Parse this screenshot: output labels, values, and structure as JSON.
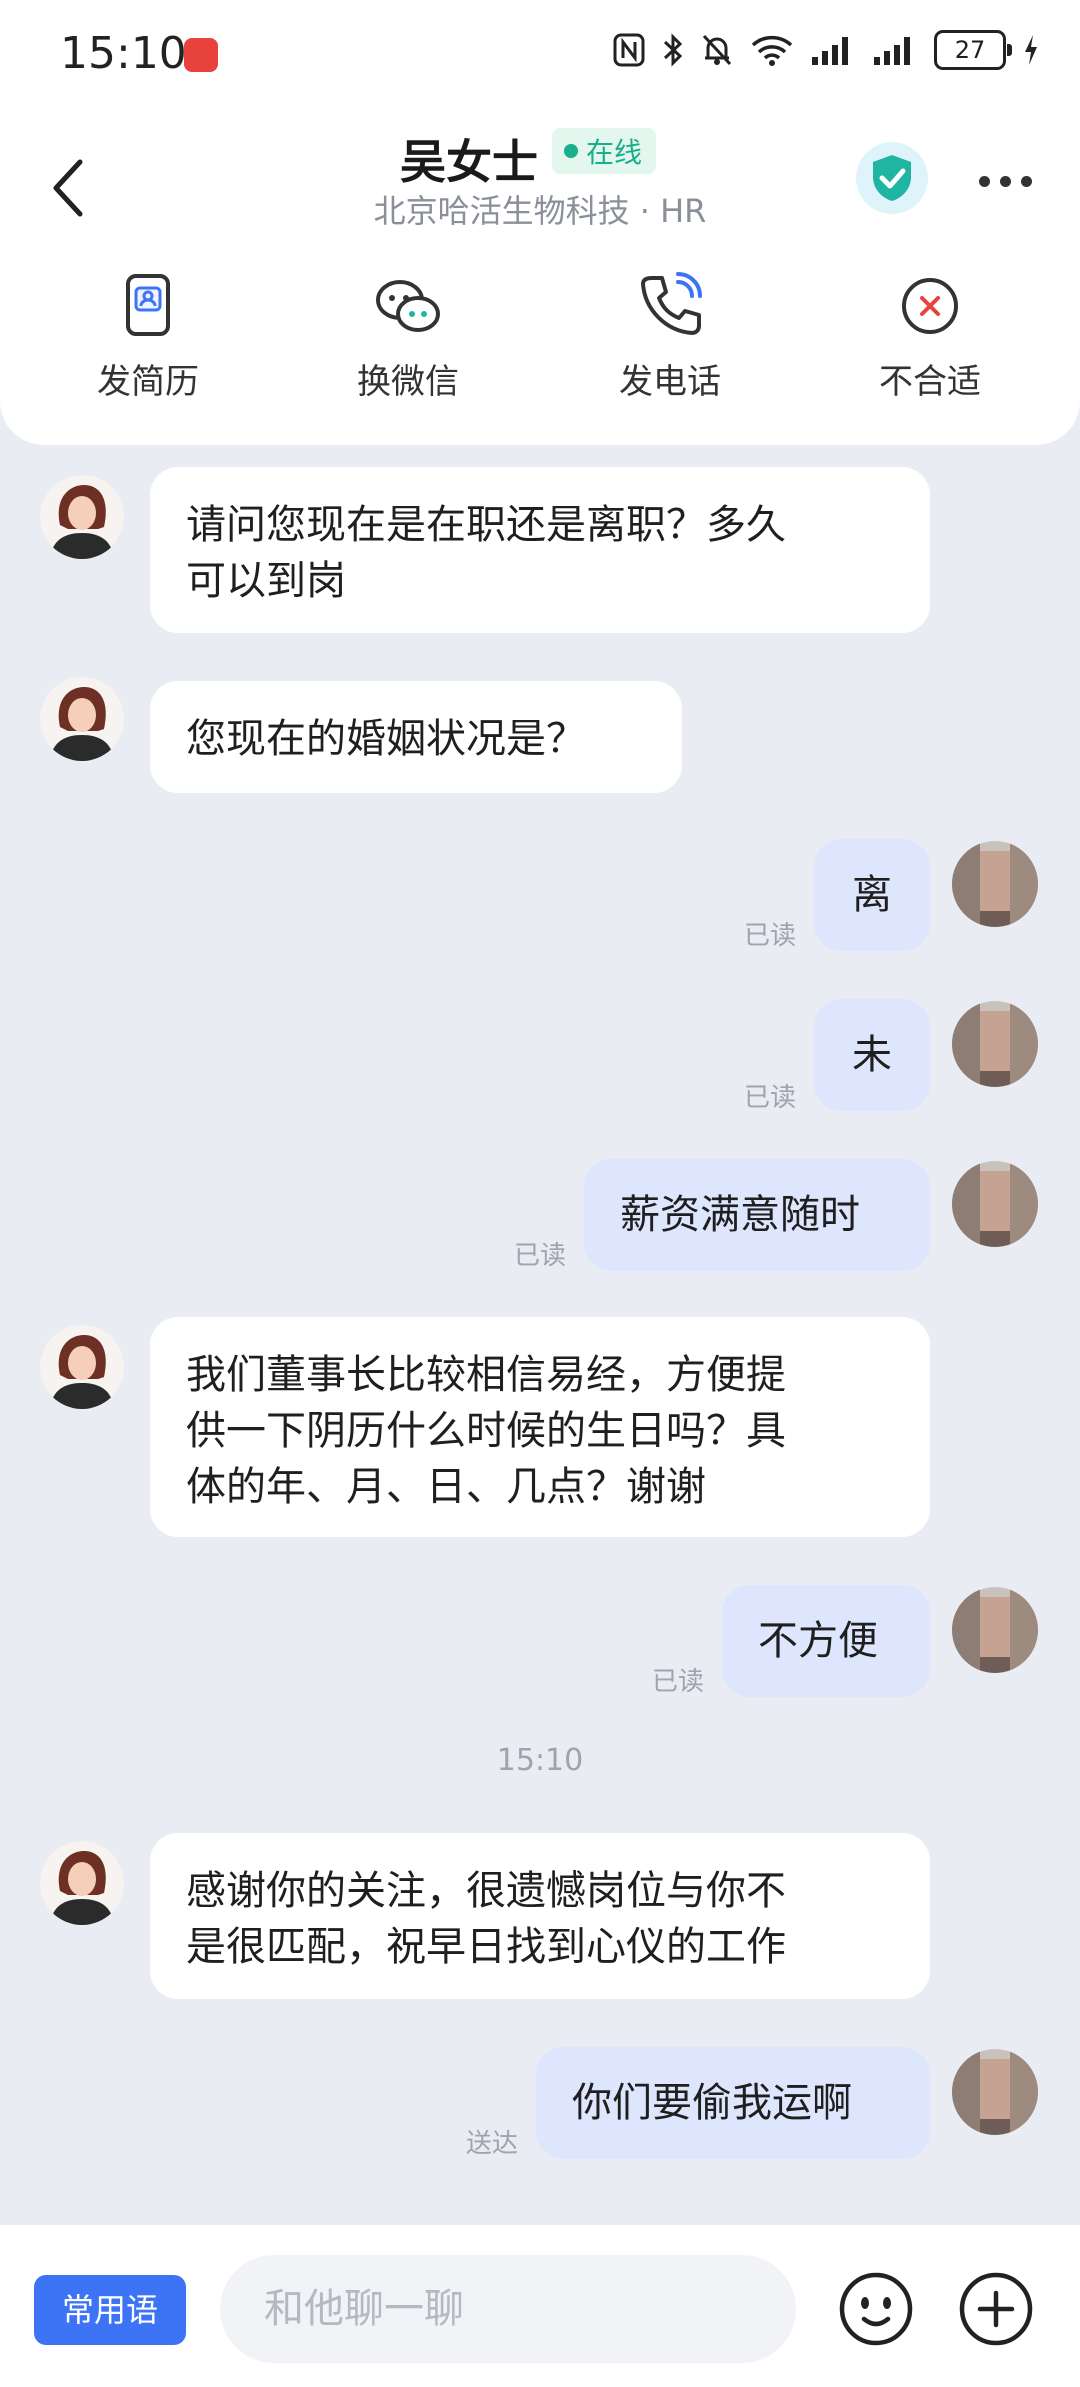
{
  "status_bar": {
    "time": "15:10",
    "battery": "27"
  },
  "header": {
    "name": "吴女士",
    "online": "在线",
    "subtitle": "北京哈活生物科技 · HR",
    "actions": [
      {
        "label": "发简历",
        "icon": "resume-icon"
      },
      {
        "label": "换微信",
        "icon": "wechat-icon"
      },
      {
        "label": "发电话",
        "icon": "phone-icon"
      },
      {
        "label": "不合适",
        "icon": "close-circle-icon"
      }
    ]
  },
  "messages": [
    {
      "from": "hr",
      "text_lines": [
        "请问您现在是在职还是离职？多久",
        "可以到岗"
      ]
    },
    {
      "from": "hr",
      "text_lines": [
        "您现在的婚姻状况是？"
      ]
    },
    {
      "from": "me",
      "text": "离",
      "status": "已读"
    },
    {
      "from": "me",
      "text": "未",
      "status": "已读"
    },
    {
      "from": "me",
      "text": "薪资满意随时",
      "status": "已读"
    },
    {
      "from": "hr",
      "text_lines": [
        "我们董事长比较相信易经，方便提",
        "供一下阴历什么时候的生日吗？具",
        "体的年、月、日、几点？谢谢"
      ]
    },
    {
      "from": "me",
      "text": "不方便",
      "status": "已读"
    },
    {
      "timestamp": "15:10"
    },
    {
      "from": "hr",
      "text_lines": [
        "感谢你的关注，很遗憾岗位与你不",
        "是很匹配，祝早日找到心仪的工作"
      ]
    },
    {
      "from": "me",
      "text": "你们要偷我运啊",
      "status": "送达"
    }
  ],
  "input_bar": {
    "phrases_label": "常用语",
    "placeholder": "和他聊一聊"
  },
  "colors": {
    "accent": "#3c74f5",
    "online": "#17b08a",
    "bubble_out": "#dde6fd",
    "background": "#e9ecf2"
  }
}
